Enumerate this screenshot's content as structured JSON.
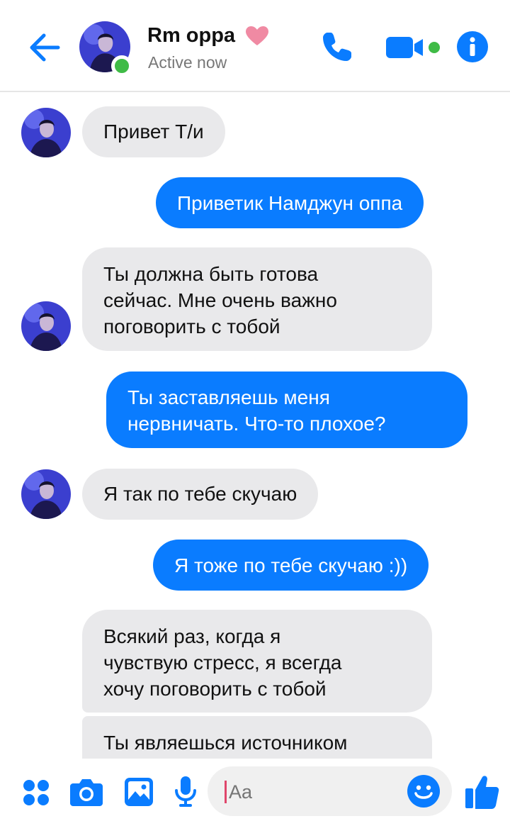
{
  "header": {
    "contact_name": "Rm oppa",
    "status": "Active now"
  },
  "messages": [
    {
      "direction": "incoming",
      "text": "Привет Т/и"
    },
    {
      "direction": "outgoing",
      "text": "Приветик Намджун оппа"
    },
    {
      "direction": "incoming",
      "lines": [
        "Ты должна быть готова",
        "сейчас. Мне очень важно",
        "поговорить с тобой"
      ]
    },
    {
      "direction": "outgoing",
      "lines": [
        "Ты заставляешь меня",
        "нервничать. Что-то плохое?"
      ]
    },
    {
      "direction": "incoming",
      "text": "Я так по тебе скучаю"
    },
    {
      "direction": "outgoing",
      "text": "Я тоже по тебе скучаю :))"
    },
    {
      "direction": "incoming",
      "lines": [
        "Всякий раз, когда я",
        "чувствую стресс, я всегда",
        "хочу поговорить с тобой"
      ]
    },
    {
      "direction": "incoming",
      "text": "Ты являешься источником"
    }
  ],
  "composer": {
    "placeholder": "Aa"
  },
  "colors": {
    "accent": "#0a7cff",
    "incoming_bubble": "#e9e9eb",
    "online": "#3fbb46",
    "heart": "#f08aa3"
  },
  "icons": [
    "back-arrow-icon",
    "heart-icon",
    "phone-icon",
    "video-camera-icon",
    "info-icon",
    "apps-grid-icon",
    "camera-icon",
    "image-icon",
    "microphone-icon",
    "emoji-icon",
    "thumbs-up-icon"
  ]
}
